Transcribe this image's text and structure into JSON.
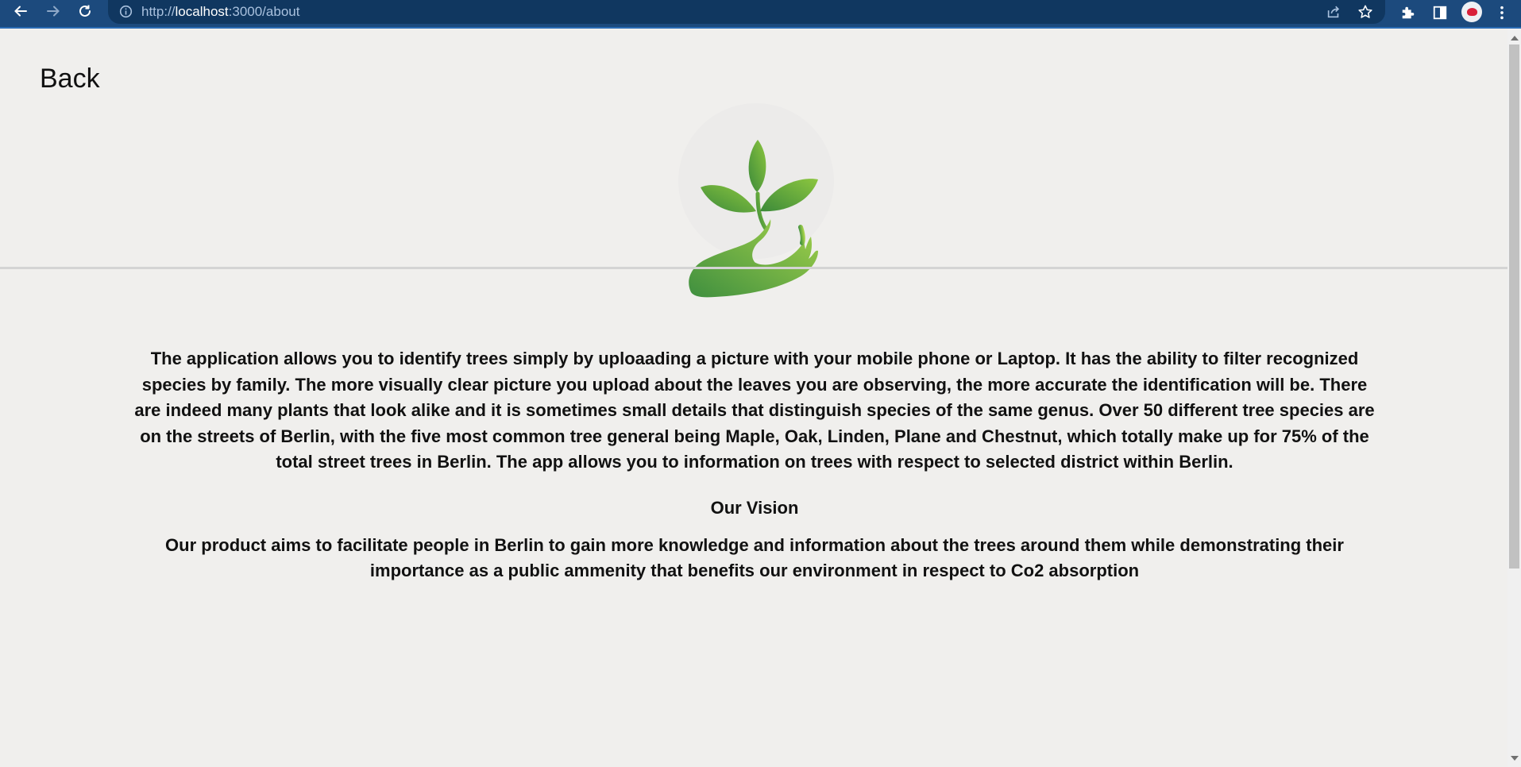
{
  "browser": {
    "url_prefix": "http://",
    "url_host": "localhost",
    "url_path": ":3000/about",
    "back_icon": "arrow-left-icon",
    "forward_icon": "arrow-right-icon",
    "reload_icon": "reload-icon",
    "info_icon": "info-icon",
    "share_icon": "share-icon",
    "bookmark_icon": "star-icon",
    "extensions_icon": "puzzle-icon",
    "sidepanel_icon": "side-panel-icon",
    "menu_icon": "kebab-menu-icon",
    "toolbar_color": "#1c4a7d",
    "omnibox_color": "#103760"
  },
  "page": {
    "back_label": "Back",
    "logo_icon": "hand-holding-plant-logo",
    "brand_green_dark": "#3a8a3d",
    "brand_green_light": "#9ccf45",
    "intro": "The application allows you to identify trees simply by uploaading a picture with your mobile phone or Laptop. It has the ability to filter recognized species by family. The more visually clear picture you upload about the leaves you are observing, the more accurate the identification will be. There are indeed many plants that look alike and it is sometimes small details that distinguish species of the same genus. Over 50 different tree species are on the streets of Berlin, with the five most common tree general being Maple, Oak, Linden, Plane and Chestnut, which totally make up for 75% of the total street trees in Berlin. The app allows you to information on trees with respect to selected district within Berlin.",
    "vision_heading": "Our Vision",
    "vision_text": "Our product aims to facilitate people in Berlin to gain more knowledge and information about the trees around them while demonstrating their importance as a public ammenity that benefits our environment in respect to Co2 absorption"
  }
}
